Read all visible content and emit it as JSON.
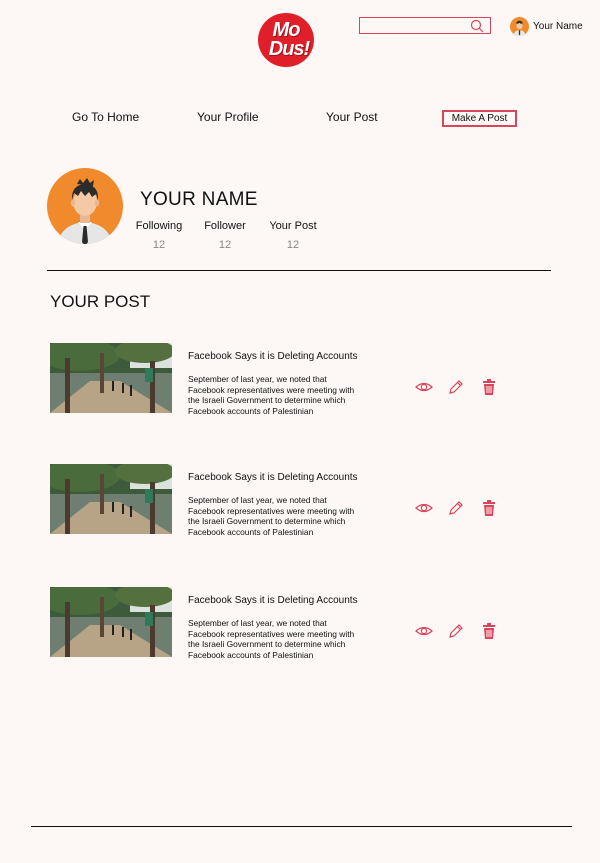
{
  "header": {
    "logo_line1": "Mo",
    "logo_line2": "Dus!",
    "search_value": "",
    "search_placeholder": "",
    "user_name": "Your Name"
  },
  "nav": {
    "home": "Go To Home",
    "profile": "Your Profile",
    "post": "Your Post",
    "make_post": "Make A Post"
  },
  "profile": {
    "name": "YOUR NAME",
    "stats": [
      {
        "label": "Following",
        "value": "12"
      },
      {
        "label": "Follower",
        "value": "12"
      },
      {
        "label": "Your Post",
        "value": "12"
      }
    ]
  },
  "section_title": "YOUR POST",
  "posts": [
    {
      "title": "Facebook Says it is Deleting Accounts",
      "body": "September of last year, we noted that Facebook representatives were meeting with the Israeli Government to determine which Facebook accounts of Palestinian"
    },
    {
      "title": "Facebook Says it is Deleting Accounts",
      "body": "September of last year, we noted that Facebook representatives were meeting with the Israeli Government to determine which Facebook accounts of Palestinian"
    },
    {
      "title": "Facebook Says it is Deleting Accounts",
      "body": "September of last year, we noted that Facebook representatives were meeting with the Israeli Government to determine which Facebook accounts of Palestinian"
    }
  ],
  "icons": {
    "view": "eye-icon",
    "edit": "pencil-icon",
    "delete": "trash-icon",
    "search": "search-icon"
  },
  "colors": {
    "accent": "#d9455a",
    "brand": "#e01f2a",
    "avatar_bg": "#f08a2c",
    "background": "#fdf8f6"
  }
}
